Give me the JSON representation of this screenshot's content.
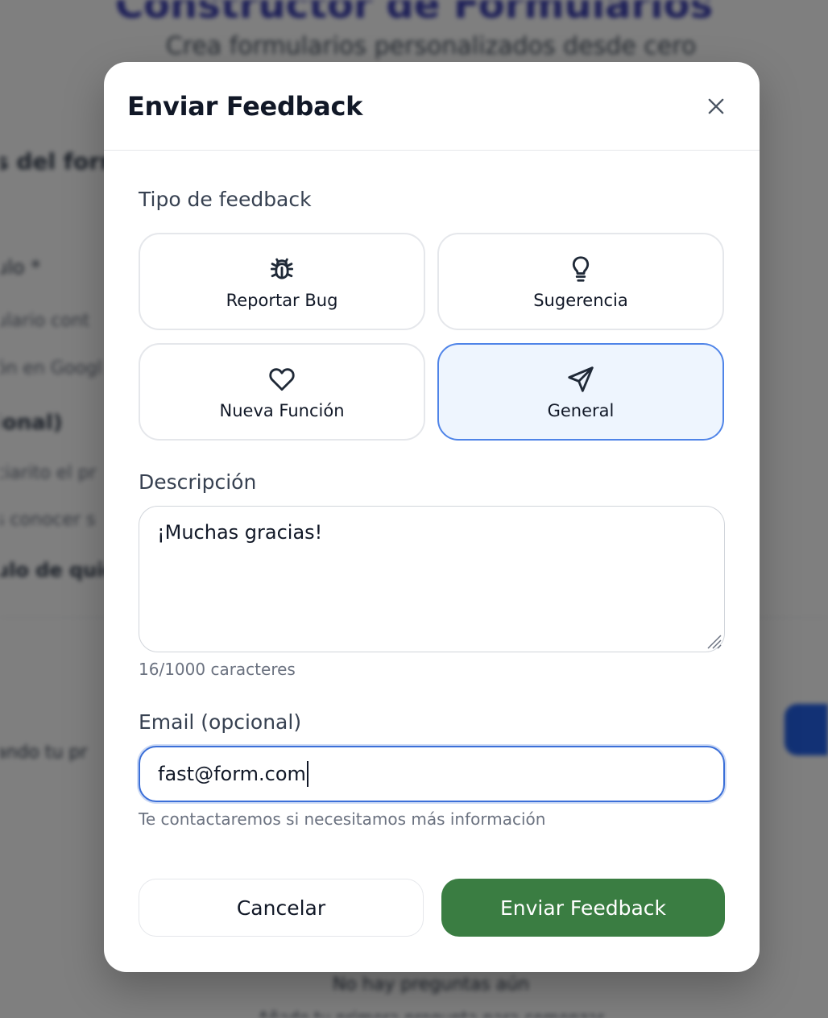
{
  "background": {
    "title": "Constructor de Formularios",
    "subtitle": "Crea formularios personalizados desde cero",
    "lines": [
      "s del form",
      "ulo *",
      "ulario cont",
      "ón en Googl",
      "ional)",
      "ciarito el pr",
      "s conocer s",
      "ulo de quie",
      "ando tu pr"
    ],
    "footer_1": "No hay preguntas aún",
    "footer_2": "Añade tu primera pregunta para comenzar"
  },
  "modal": {
    "title": "Enviar Feedback",
    "feedback_type_label": "Tipo de feedback",
    "types": [
      {
        "label": "Reportar Bug",
        "icon": "bug-icon",
        "selected": false
      },
      {
        "label": "Sugerencia",
        "icon": "lightbulb-icon",
        "selected": false
      },
      {
        "label": "Nueva Función",
        "icon": "heart-icon",
        "selected": false
      },
      {
        "label": "General",
        "icon": "send-icon",
        "selected": true
      }
    ],
    "description_label": "Descripción",
    "description_value": "¡Muchas gracias!",
    "char_count": "16/1000 caracteres",
    "email_label": "Email (opcional)",
    "email_value": "fast@form.com",
    "email_hint": "Te contactaremos si necesitamos más información",
    "cancel_label": "Cancelar",
    "submit_label": "Enviar Feedback"
  },
  "colors": {
    "selected_border": "#4f84e8",
    "selected_bg": "#eef5fe",
    "submit_bg": "#3a7d42",
    "focus_border": "#3b6fd8"
  }
}
